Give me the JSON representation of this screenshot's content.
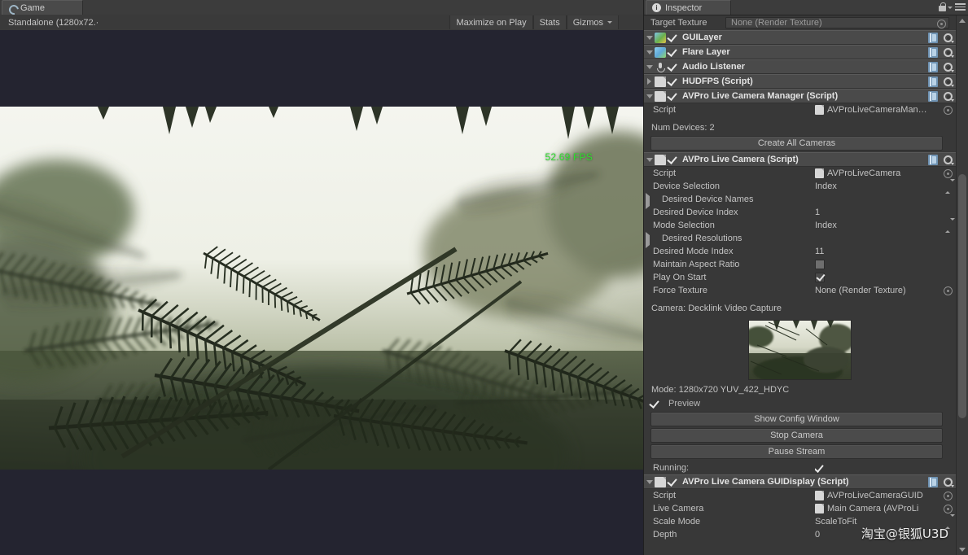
{
  "game_view": {
    "tab_label": "Game",
    "tab_icon": "game-icon",
    "aspect_label": "Standalone (1280x72.·",
    "toolbar": {
      "maximize_on_play": "Maximize on Play",
      "stats": "Stats",
      "gizmos": "Gizmos"
    },
    "fps_overlay": "52.69 FPS",
    "fps_color": "#2ee02e",
    "background_color": "#242430"
  },
  "inspector": {
    "tab_label": "Inspector",
    "tab_icon": "info-icon",
    "lock_icon": "lock-icon",
    "menu_icon": "hamburger-menu-icon",
    "target_texture": {
      "label": "Target Texture",
      "value": "None (Render Texture)"
    },
    "components": [
      {
        "title": "GUILayer",
        "enabled": true,
        "expanded": true,
        "icon": "gui-layer-icon"
      },
      {
        "title": "Flare Layer",
        "enabled": true,
        "expanded": true,
        "icon": "flare-layer-icon"
      },
      {
        "title": "Audio Listener",
        "enabled": true,
        "expanded": true,
        "icon": "audio-listener-icon"
      },
      {
        "title": "HUDFPS (Script)",
        "enabled": true,
        "expanded": false,
        "icon": "script-icon"
      }
    ],
    "manager": {
      "title": "AVPro Live Camera Manager (Script)",
      "enabled": true,
      "script_label": "Script",
      "script_value": "AVProLiveCameraMan…",
      "num_devices": "Num Devices: 2",
      "create_all_button": "Create All Cameras"
    },
    "live_camera": {
      "title": "AVPro Live Camera (Script)",
      "enabled": true,
      "rows": [
        {
          "label": "Script",
          "value": "AVProLiveCamera",
          "kind": "object"
        },
        {
          "label": "Device Selection",
          "value": "Index",
          "kind": "enum"
        },
        {
          "label": "Desired Device Names",
          "value": "",
          "kind": "foldout"
        },
        {
          "label": "Desired Device Index",
          "value": "1",
          "kind": "text"
        },
        {
          "label": "Mode Selection",
          "value": "Index",
          "kind": "enum"
        },
        {
          "label": "Desired Resolutions",
          "value": "",
          "kind": "foldout"
        },
        {
          "label": "Desired Mode Index",
          "value": "11",
          "kind": "text"
        },
        {
          "label": "Maintain Aspect Ratio",
          "value": "",
          "kind": "checkbox-off"
        },
        {
          "label": "Play On Start",
          "value": "",
          "kind": "checkbox-on"
        },
        {
          "label": "Force Texture",
          "value": "None (Render Texture)",
          "kind": "object-plain"
        }
      ],
      "camera_line": "Camera: Decklink Video Capture",
      "mode_line": "Mode: 1280x720 YUV_422_HDYC",
      "preview_label": "Preview",
      "preview_checked": true,
      "buttons": [
        "Show Config Window",
        "Stop Camera",
        "Pause Stream"
      ],
      "running_label": "Running:",
      "running_checked": true
    },
    "gui_display": {
      "title": "AVPro Live Camera GUIDisplay (Script)",
      "enabled": true,
      "rows": [
        {
          "label": "Script",
          "value": "AVProLiveCameraGUID",
          "kind": "object"
        },
        {
          "label": "Live Camera",
          "value": "Main Camera (AVProLi",
          "kind": "object"
        },
        {
          "label": "Scale Mode",
          "value": "ScaleToFit",
          "kind": "enum"
        },
        {
          "label": "Depth",
          "value": "0",
          "kind": "text"
        }
      ]
    }
  },
  "watermark": "淘宝@银狐U3D"
}
